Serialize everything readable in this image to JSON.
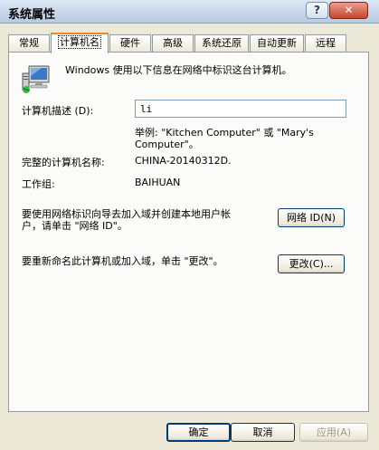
{
  "window": {
    "title": "系统属性",
    "help_label": "?",
    "close_label": "✕"
  },
  "tabs": [
    {
      "label": "常规"
    },
    {
      "label": "计算机名"
    },
    {
      "label": "硬件"
    },
    {
      "label": "高级"
    },
    {
      "label": "系统还原"
    },
    {
      "label": "自动更新"
    },
    {
      "label": "远程"
    }
  ],
  "panel": {
    "intro": "Windows 使用以下信息在网络中标识这台计算机。",
    "description_label": "计算机描述 (D):",
    "description_value": "li",
    "example_line1": "举例: \"Kitchen Computer\" 或 \"Mary's",
    "example_line2": "Computer\"。",
    "full_name_label": "完整的计算机名称:",
    "full_name_value": "CHINA-20140312D.",
    "workgroup_label": "工作组:",
    "workgroup_value": "BAIHUAN",
    "network_text_line1": "要使用网络标识向导去加入域并创建本地用户帐",
    "network_text_line2": "户，请单击 \"网络 ID\"。",
    "network_id_button": "网络 ID(N)",
    "rename_text": "要重新命名此计算机或加入域，单击 \"更改\"。",
    "change_button": "更改(C)..."
  },
  "buttons": {
    "ok": "确定",
    "cancel": "取消",
    "apply": "应用(A)"
  }
}
